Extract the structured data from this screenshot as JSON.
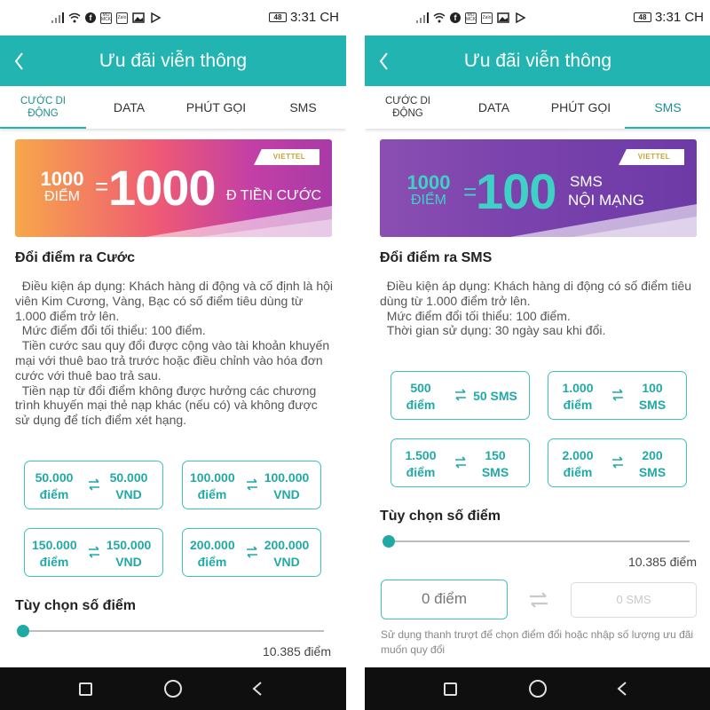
{
  "status_bar": {
    "time": "3:31 CH",
    "battery": "48",
    "app_icon_1": "MO MCK",
    "app_icon_2": "Zalo",
    "app_icon_3": "f"
  },
  "icons": {
    "back": "chevron-left-icon",
    "swap": "swap-arrows-icon",
    "nav_recent": "square-icon",
    "nav_home": "circle-icon",
    "nav_back": "triangle-back-icon"
  },
  "colors": {
    "teal": "#21b4b1",
    "teal_text": "#21a9a6",
    "nav_bg": "#0f0f0f"
  },
  "left": {
    "header": {
      "title": "Ưu đãi viễn thông"
    },
    "tabs": [
      {
        "label": "CƯỚC DI\nĐỘNG",
        "active": true
      },
      {
        "label": "DATA",
        "active": false
      },
      {
        "label": "PHÚT GỌI",
        "active": false
      },
      {
        "label": "SMS",
        "active": false
      }
    ],
    "banner": {
      "logo": "VIETTEL",
      "points": "1000",
      "points_unit": "ĐIỂM",
      "equals": "=",
      "value": "1000",
      "suffix": "Đ TIỀN CƯỚC"
    },
    "section": {
      "title": "Đổi điểm ra Cước",
      "description": "  Điều kiện áp dụng: Khách hàng di động và cố định là hội viên Kim Cương, Vàng, Bạc có số điểm tiêu dùng từ 1.000 điểm trở lên.\n  Mức điểm đổi tối thiểu: 100 điểm.\n  Tiền cước sau quy đổi được cộng vào tài khoản khuyến mại với thuê bao trả trước hoặc điều chỉnh vào hóa đơn cước với thuê bao trả sau.\n  Tiền nạp từ đổi điểm không được hưởng các chương trình khuyến mại thẻ nạp khác (nếu có) và không được sử dụng để tích điểm xét hạng."
    },
    "options": [
      {
        "points": "50.000\nđiểm",
        "value": "50.000\nVND"
      },
      {
        "points": "100.000\nđiểm",
        "value": "100.000\nVND"
      },
      {
        "points": "150.000\nđiểm",
        "value": "150.000\nVND"
      },
      {
        "points": "200.000\nđiểm",
        "value": "200.000\nVND"
      }
    ],
    "custom": {
      "title": "Tùy chọn số điểm",
      "slider_value": "10.385 điểm",
      "slider_position": 0
    }
  },
  "right": {
    "header": {
      "title": "Ưu đãi viễn thông"
    },
    "tabs": [
      {
        "label": "CƯỚC DI\nĐỘNG",
        "active": false
      },
      {
        "label": "DATA",
        "active": false
      },
      {
        "label": "PHÚT GỌI",
        "active": false
      },
      {
        "label": "SMS",
        "active": true
      }
    ],
    "banner": {
      "logo": "VIETTEL",
      "points": "1000",
      "points_unit": "ĐIỂM",
      "equals": "=",
      "value": "100",
      "suffix_line1": "SMS",
      "suffix_line2": "NỘI MẠNG"
    },
    "section": {
      "title": "Đổi điểm ra SMS",
      "description": "  Điều kiện áp dụng: Khách hàng di động có số điểm tiêu dùng từ 1.000 điểm trở lên.\n  Mức điểm đổi tối thiểu: 100 điểm.\n  Thời gian sử dụng: 30 ngày sau khi đổi."
    },
    "options": [
      {
        "points": "500\nđiểm",
        "value": "50 SMS"
      },
      {
        "points": "1.000\nđiểm",
        "value": "100\nSMS"
      },
      {
        "points": "1.500\nđiểm",
        "value": "150\nSMS"
      },
      {
        "points": "2.000\nđiểm",
        "value": "200\nSMS"
      }
    ],
    "custom": {
      "title": "Tùy chọn số điểm",
      "slider_value": "10.385 điểm",
      "slider_position": 0,
      "points_input": "0 điểm",
      "sms_output": "0 SMS",
      "hint": "Sử dụng thanh trượt để chọn điểm đổi hoặc nhập số lượng ưu đãi muốn quy đổi"
    }
  }
}
